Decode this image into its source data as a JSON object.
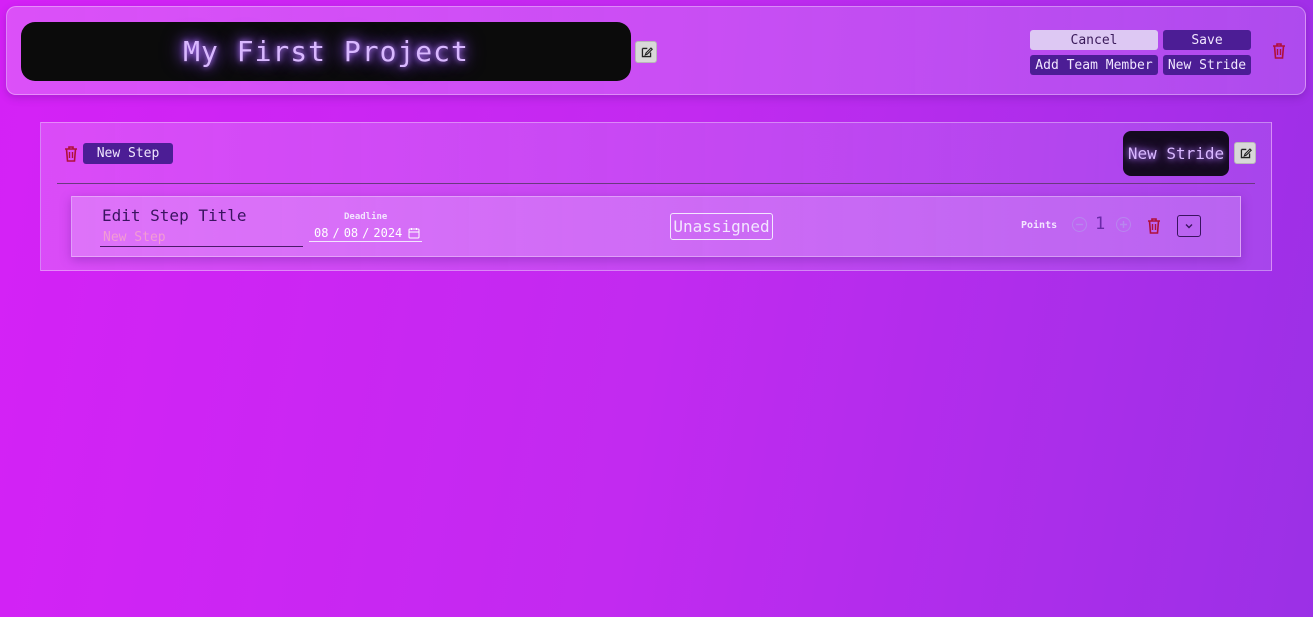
{
  "project": {
    "title": "My First Project",
    "edit_icon": "edit-icon",
    "buttons": {
      "cancel": "Cancel",
      "save": "Save",
      "add_team_member": "Add Team Member",
      "new_stride": "New Stride"
    },
    "delete_icon": "trash-icon"
  },
  "stride": {
    "title": "New Stride",
    "new_step_label": "New Step",
    "delete_icon": "trash-icon",
    "edit_icon": "edit-icon"
  },
  "step": {
    "title_label": "Edit Step Title",
    "title_placeholder": "New Step",
    "deadline_label": "Deadline",
    "deadline": {
      "month": "08",
      "day": "08",
      "year": "2024",
      "sep": "/"
    },
    "assignee": "Unassigned",
    "points_label": "Points",
    "points_value": "1",
    "decrement_icon": "minus-circle-icon",
    "increment_icon": "plus-circle-icon",
    "delete_icon": "trash-icon",
    "expand_icon": "chevron-down-icon"
  },
  "colors": {
    "accent_dark": "#4c1d95",
    "danger": "#b0103a",
    "glow": "#d9b8ff"
  }
}
